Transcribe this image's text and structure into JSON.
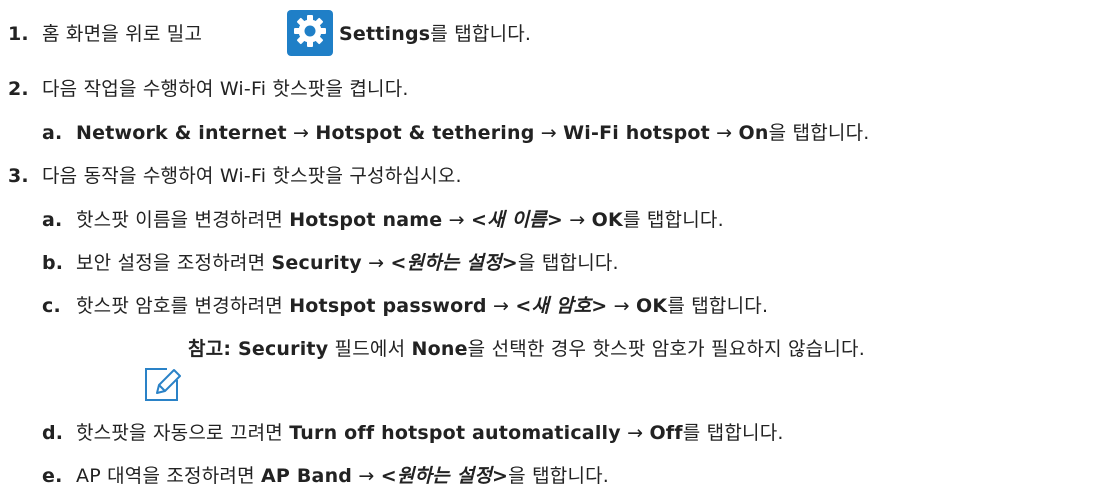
{
  "step1": {
    "num": "1.",
    "pre": "홈 화면을 위로 밀고",
    "icon": "settings-gear-icon",
    "bold": "Settings",
    "post": "를 탭합니다."
  },
  "step2": {
    "num": "2.",
    "text": "다음 작업을 수행하여 Wi-Fi 핫스팟을 켭니다.",
    "a": {
      "letter": "a.",
      "p1": "Network & internet",
      "arr1": " → ",
      "p2": "Hotspot & tethering",
      "arr2": " → ",
      "p3": "Wi-Fi hotspot",
      "arr3": " → ",
      "p4": "On",
      "post": "을 탭합니다."
    }
  },
  "step3": {
    "num": "3.",
    "text": "다음 동작을 수행하여 Wi-Fi 핫스팟을 구성하십시오.",
    "a": {
      "letter": "a.",
      "pre": "핫스팟 이름을 변경하려면 ",
      "b1": "Hotspot name",
      "arr1": " → ",
      "i1": "<새 이름>",
      "arr2": " → ",
      "b2": "OK",
      "post": "를 탭합니다."
    },
    "b": {
      "letter": "b.",
      "pre": "보안 설정을 조정하려면 ",
      "b1": "Security",
      "arr1": " → ",
      "i1": "<원하는 설정>",
      "post": "을 탭합니다."
    },
    "c": {
      "letter": "c.",
      "pre": "핫스팟 암호를 변경하려면 ",
      "b1": "Hotspot password",
      "arr1": " → ",
      "i1": "<새 암호>",
      "arr2": " → ",
      "b2": "OK",
      "post": "를 탭합니다."
    },
    "note": {
      "icon": "note-pencil-icon",
      "label": "참고: ",
      "b1": "Security",
      "mid": " 필드에서 ",
      "b2": "None",
      "post": "을 선택한 경우 핫스팟 암호가 필요하지 않습니다."
    },
    "d": {
      "letter": "d.",
      "pre": "핫스팟을 자동으로 끄려면 ",
      "b1": "Turn off hotspot automatically",
      "arr1": " → ",
      "b2": "Off",
      "post": "를 탭합니다."
    },
    "e": {
      "letter": "e.",
      "pre": "AP 대역을 조정하려면 ",
      "b1": "AP Band",
      "arr1": " → ",
      "i1": "<원하는 설정>",
      "post": "을 탭합니다."
    }
  }
}
